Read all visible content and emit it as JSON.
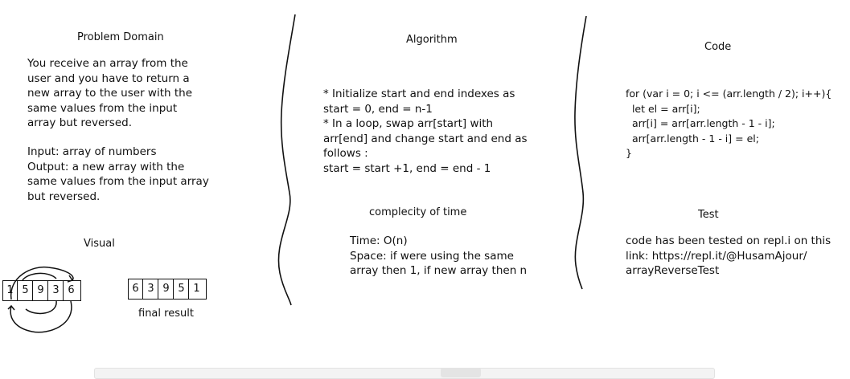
{
  "problem_domain": {
    "title": "Problem Domain",
    "description": "You receive an array from the\nuser and you have to return a\nnew array to the user with the\nsame values from the input\narray but reversed.",
    "io": "Input: array of numbers\nOutput: a new array with the\nsame values from the input array\nbut reversed."
  },
  "visual": {
    "title": "Visual",
    "input_array": [
      "1",
      "5",
      "9",
      "3",
      "6"
    ],
    "output_array": [
      "6",
      "3",
      "9",
      "5",
      "1"
    ],
    "caption": "final result"
  },
  "algorithm": {
    "title": "Algorithm",
    "steps": "* Initialize start and end indexes as\nstart = 0, end = n-1\n* In a loop, swap arr[start] with\narr[end] and change start and end as\nfollows :\nstart = start +1, end = end - 1"
  },
  "complexity": {
    "title": "complecity of time",
    "text": "Time: O(n)\nSpace: if were using the same\narray then 1, if new array then n"
  },
  "code": {
    "title": "Code",
    "source": "for (var i = 0; i <= (arr.length / 2); i++){\n  let el = arr[i];\n  arr[i] = arr[arr.length - 1 - i];\n  arr[arr.length - 1 - i] = el;\n}"
  },
  "test": {
    "title": "Test",
    "text": "code has been tested on repl.i on this\nlink: https://repl.it/@HusamAjour/\narrayReverseTest"
  }
}
